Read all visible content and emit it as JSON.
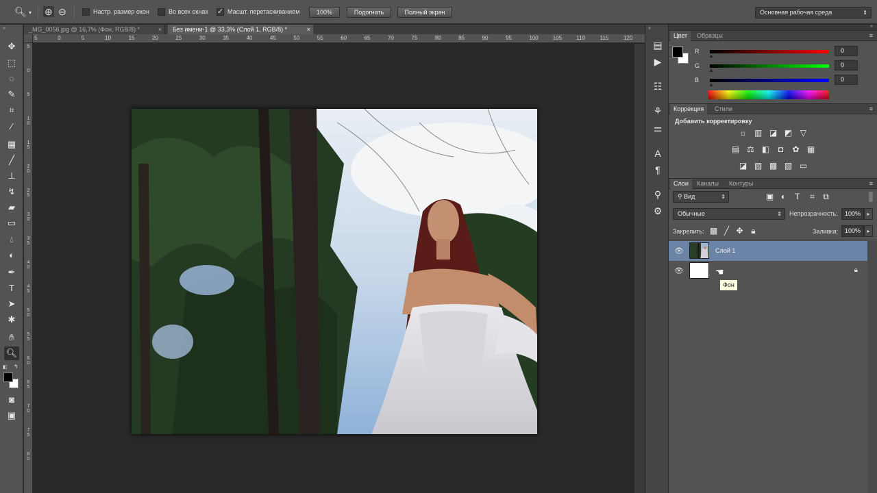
{
  "options_bar": {
    "checkbox_resize_label": "Настр. размер окон",
    "checkbox_all_windows_label": "Во всех окнах",
    "checkbox_scrubby_label": "Масшт. перетаскиванием",
    "zoom_btn_label": "100%",
    "fit_btn_label": "Подогнать",
    "fill_btn_label": "Полный экран",
    "workspace_label": "Основная рабочая среда"
  },
  "tabs": [
    {
      "label": "_MG_0056.jpg @ 16,7% (Фон, RGB/8) *",
      "close": "×"
    },
    {
      "label": "Без имени-1 @ 33,3% (Слой 1, RGB/8) *",
      "close": "×"
    }
  ],
  "ruler_top_ticks": [
    "5",
    "0",
    "5",
    "10",
    "15",
    "20",
    "25",
    "30",
    "35",
    "40",
    "45",
    "50",
    "55",
    "60",
    "65",
    "70",
    "75",
    "80",
    "85",
    "90",
    "95",
    "100",
    "105",
    "110",
    "115",
    "120"
  ],
  "ruler_left_ticks": [
    "5",
    "0",
    "5",
    "1 0",
    "1 5",
    "2 0",
    "2 5",
    "3 0",
    "3 5",
    "4 0",
    "4 5",
    "5 0",
    "5 5",
    "6 0",
    "6 5",
    "7 0",
    "7 5",
    "8 0"
  ],
  "color_panel": {
    "tabs": [
      "Цвет",
      "Образцы"
    ],
    "r_label": "R",
    "r_value": "0",
    "g_label": "G",
    "g_value": "0",
    "b_label": "B",
    "b_value": "0"
  },
  "adjustments_panel": {
    "tabs": [
      "Коррекция",
      "Стили"
    ],
    "heading": "Добавить корректировку"
  },
  "layers_panel": {
    "tabs": [
      "Слои",
      "Каналы",
      "Контуры"
    ],
    "filter_label": "Вид",
    "blend_mode": "Обычные",
    "opacity_label": "Непрозрачность:",
    "opacity_value": "100%",
    "lock_label": "Закрепить:",
    "fill_label": "Заливка:",
    "fill_value": "100%",
    "layers": [
      {
        "name": "Слой 1",
        "selected": true
      },
      {
        "name": "",
        "selected": false,
        "locked": true
      }
    ],
    "tooltip": "Фон"
  },
  "colors": {
    "accent_selected_layer": "#6b83a6",
    "panel_bg": "#535353",
    "canvas_bg": "#282828"
  }
}
